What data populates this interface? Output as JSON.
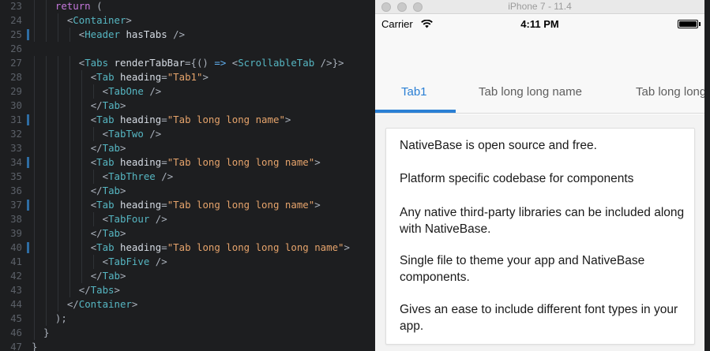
{
  "editor": {
    "lines": [
      {
        "num": "23",
        "changed": false,
        "indent": 2,
        "tokens": [
          [
            "kw",
            "return"
          ],
          [
            "pun",
            " ("
          ]
        ]
      },
      {
        "num": "24",
        "changed": false,
        "indent": 3,
        "tokens": [
          [
            "pun",
            "<"
          ],
          [
            "tag",
            "Container"
          ],
          [
            "pun",
            ">"
          ]
        ]
      },
      {
        "num": "25",
        "changed": true,
        "indent": 4,
        "tokens": [
          [
            "pun",
            "<"
          ],
          [
            "tag",
            "Header"
          ],
          [
            "attr",
            " hasTabs"
          ],
          [
            "pun",
            " />"
          ]
        ]
      },
      {
        "num": "26",
        "changed": false,
        "indent": 0,
        "tokens": []
      },
      {
        "num": "27",
        "changed": false,
        "indent": 4,
        "tokens": [
          [
            "pun",
            "<"
          ],
          [
            "tag",
            "Tabs"
          ],
          [
            "attr",
            " renderTabBar"
          ],
          [
            "pun",
            "={() "
          ],
          [
            "fn",
            "=>"
          ],
          [
            "pun",
            " <"
          ],
          [
            "tag",
            "ScrollableTab"
          ],
          [
            "pun",
            " />}>"
          ]
        ]
      },
      {
        "num": "28",
        "changed": false,
        "indent": 5,
        "tokens": [
          [
            "pun",
            "<"
          ],
          [
            "tag",
            "Tab"
          ],
          [
            "attr",
            " heading"
          ],
          [
            "pun",
            "="
          ],
          [
            "str",
            "\"Tab1\""
          ],
          [
            "pun",
            ">"
          ]
        ]
      },
      {
        "num": "29",
        "changed": false,
        "indent": 6,
        "tokens": [
          [
            "pun",
            "<"
          ],
          [
            "tag",
            "TabOne"
          ],
          [
            "pun",
            " />"
          ]
        ]
      },
      {
        "num": "30",
        "changed": false,
        "indent": 5,
        "tokens": [
          [
            "pun",
            "</"
          ],
          [
            "tag",
            "Tab"
          ],
          [
            "pun",
            ">"
          ]
        ]
      },
      {
        "num": "31",
        "changed": true,
        "indent": 5,
        "tokens": [
          [
            "pun",
            "<"
          ],
          [
            "tag",
            "Tab"
          ],
          [
            "attr",
            " heading"
          ],
          [
            "pun",
            "="
          ],
          [
            "str",
            "\"Tab long long name\""
          ],
          [
            "pun",
            ">"
          ]
        ]
      },
      {
        "num": "32",
        "changed": false,
        "indent": 6,
        "tokens": [
          [
            "pun",
            "<"
          ],
          [
            "tag",
            "TabTwo"
          ],
          [
            "pun",
            " />"
          ]
        ]
      },
      {
        "num": "33",
        "changed": false,
        "indent": 5,
        "tokens": [
          [
            "pun",
            "</"
          ],
          [
            "tag",
            "Tab"
          ],
          [
            "pun",
            ">"
          ]
        ]
      },
      {
        "num": "34",
        "changed": true,
        "indent": 5,
        "tokens": [
          [
            "pun",
            "<"
          ],
          [
            "tag",
            "Tab"
          ],
          [
            "attr",
            " heading"
          ],
          [
            "pun",
            "="
          ],
          [
            "str",
            "\"Tab long long long name\""
          ],
          [
            "pun",
            ">"
          ]
        ]
      },
      {
        "num": "35",
        "changed": false,
        "indent": 6,
        "tokens": [
          [
            "pun",
            "<"
          ],
          [
            "tag",
            "TabThree"
          ],
          [
            "pun",
            " />"
          ]
        ]
      },
      {
        "num": "36",
        "changed": false,
        "indent": 5,
        "tokens": [
          [
            "pun",
            "</"
          ],
          [
            "tag",
            "Tab"
          ],
          [
            "pun",
            ">"
          ]
        ]
      },
      {
        "num": "37",
        "changed": true,
        "indent": 5,
        "tokens": [
          [
            "pun",
            "<"
          ],
          [
            "tag",
            "Tab"
          ],
          [
            "attr",
            " heading"
          ],
          [
            "pun",
            "="
          ],
          [
            "str",
            "\"Tab long long long name\""
          ],
          [
            "pun",
            ">"
          ]
        ]
      },
      {
        "num": "38",
        "changed": false,
        "indent": 6,
        "tokens": [
          [
            "pun",
            "<"
          ],
          [
            "tag",
            "TabFour"
          ],
          [
            "pun",
            " />"
          ]
        ]
      },
      {
        "num": "39",
        "changed": false,
        "indent": 5,
        "tokens": [
          [
            "pun",
            "</"
          ],
          [
            "tag",
            "Tab"
          ],
          [
            "pun",
            ">"
          ]
        ]
      },
      {
        "num": "40",
        "changed": true,
        "indent": 5,
        "tokens": [
          [
            "pun",
            "<"
          ],
          [
            "tag",
            "Tab"
          ],
          [
            "attr",
            " heading"
          ],
          [
            "pun",
            "="
          ],
          [
            "str",
            "\"Tab long long long long name\""
          ],
          [
            "pun",
            ">"
          ]
        ]
      },
      {
        "num": "41",
        "changed": false,
        "indent": 6,
        "tokens": [
          [
            "pun",
            "<"
          ],
          [
            "tag",
            "TabFive"
          ],
          [
            "pun",
            " />"
          ]
        ]
      },
      {
        "num": "42",
        "changed": false,
        "indent": 5,
        "tokens": [
          [
            "pun",
            "</"
          ],
          [
            "tag",
            "Tab"
          ],
          [
            "pun",
            ">"
          ]
        ]
      },
      {
        "num": "43",
        "changed": false,
        "indent": 4,
        "tokens": [
          [
            "pun",
            "</"
          ],
          [
            "tag",
            "Tabs"
          ],
          [
            "pun",
            ">"
          ]
        ]
      },
      {
        "num": "44",
        "changed": false,
        "indent": 3,
        "tokens": [
          [
            "pun",
            "</"
          ],
          [
            "tag",
            "Container"
          ],
          [
            "pun",
            ">"
          ]
        ]
      },
      {
        "num": "45",
        "changed": false,
        "indent": 2,
        "tokens": [
          [
            "pun",
            ");"
          ]
        ]
      },
      {
        "num": "46",
        "changed": false,
        "indent": 1,
        "tokens": [
          [
            "pun",
            "}"
          ]
        ]
      },
      {
        "num": "47",
        "changed": false,
        "indent": 0,
        "tokens": [
          [
            "pun",
            "}"
          ]
        ]
      }
    ]
  },
  "simulator": {
    "window_title": "iPhone 7 - 11.4",
    "status": {
      "carrier": "Carrier",
      "time": "4:11 PM",
      "battery_fraction": 1.0,
      "wifi_icon": "wifi-icon"
    },
    "tabs": [
      {
        "label": "Tab1",
        "active": true
      },
      {
        "label": "Tab long long name",
        "active": false
      },
      {
        "label": "Tab long long long name",
        "active": false
      }
    ],
    "card_items": [
      "NativeBase is open source and free.",
      "Platform specific codebase for components",
      "Any native third-party libraries can be included along with NativeBase.",
      "Single file to theme your app and NativeBase components.",
      "Gives an ease to include different font types in your app."
    ],
    "colors": {
      "accent": "#2a7fd4"
    }
  }
}
